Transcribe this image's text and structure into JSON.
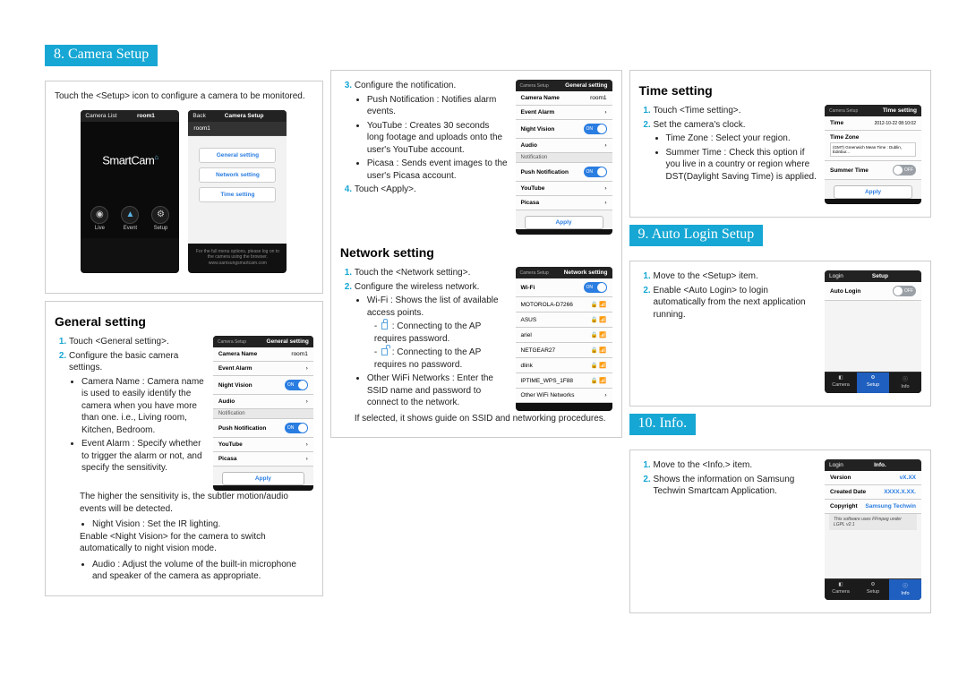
{
  "sections": {
    "camera_setup": {
      "title": "8. Camera Setup",
      "intro": "Touch the <Setup> icon to configure a camera to be monitored.",
      "general": {
        "heading": "General setting",
        "step1": "Touch <General setting>.",
        "step2": "Configure the basic camera settings.",
        "b1": "Camera Name : Camera name is used to easily identify the camera when you have more than one. i.e., Living room, Kitchen, Bedroom.",
        "b2": "Event Alarm : Specify whether to trigger the alarm or not, and specify the sensitivity.",
        "b2_note": "The higher the sensitivity is, the subtler motion/audio events will be detected.",
        "b3": "Night Vision : Set the IR lighting.",
        "b3_note": "Enable <Night Vision> for the camera to switch automatically to night vision mode.",
        "b4": "Audio : Adjust the volume of the built-in microphone and speaker of the camera as appropriate."
      },
      "network": {
        "heading": "Network setting",
        "n3": "Configure the notification.",
        "n3_b1": "Push Notification : Notifies alarm events.",
        "n3_b2": "YouTube : Creates 30 seconds long footage and uploads onto the user's YouTube account.",
        "n3_b3": "Picasa : Sends event images to the user's Picasa account.",
        "n4": "Touch <Apply>.",
        "step1": "Touch the <Network setting>.",
        "step2": "Configure the wireless network.",
        "s2_b1": "Wi-Fi : Shows the list of available access points.",
        "s2_b1a": ": Connecting to the AP requires password.",
        "s2_b1b": ": Connecting to the AP requires no password.",
        "s2_b2": "Other WiFi Networks : Enter the SSID name and password to connect to the network.",
        "note": "If selected, it shows guide on SSID and networking procedures."
      }
    },
    "time": {
      "heading": "Time setting",
      "t1": "Touch <Time setting>.",
      "t2": "Set the camera's clock.",
      "t2_b1": "Time Zone : Select your region.",
      "t2_b2": "Summer Time : Check this option if you live in a country or region where DST(Daylight Saving Time) is applied."
    },
    "auto_login": {
      "title": "9. Auto Login Setup",
      "a1": "Move to the <Setup> item.",
      "a2": "Enable <Auto Login> to login automatically from the next application running."
    },
    "info": {
      "title": "10. Info.",
      "i1": "Move to the <Info.> item.",
      "i2": "Shows the information on Samsung Techwin Smartcam Application."
    }
  },
  "shots": {
    "home": {
      "topbar_left": "Camera List",
      "topbar_title": "room1",
      "brand": "SmartCam",
      "live": "Live",
      "event": "Event",
      "setup": "Setup"
    },
    "setup_menu": {
      "back": "Back",
      "title": "Camera Setup",
      "room": "room1",
      "m1": "General setting",
      "m2": "Network setting",
      "m3": "Time setting",
      "foot": "For the full menu options, please log on to the camera using the browser.",
      "url": "www.samsungsmartcam.com"
    },
    "general": {
      "crumb": "Camera Setup",
      "title": "General setting",
      "r1": "Camera Name",
      "r1v": "room1",
      "r2": "Event Alarm",
      "r3": "Night Vision",
      "r4": "Audio",
      "grp": "Notification",
      "r5": "Push Notification",
      "r6": "YouTube",
      "r7": "Picasa",
      "apply": "Apply",
      "on": "ON"
    },
    "network": {
      "crumb": "Camera Setup",
      "title": "Network setting",
      "wifi": "Wi-Fi",
      "ap1": "MOTOROLA-D7266",
      "ap2": "ASUS",
      "ap3": "ariel",
      "ap4": "NETGEAR27",
      "ap5": "dlink",
      "ap6": "IPTIME_WPS_1F88",
      "other": "Other WiFi Networks",
      "on": "ON"
    },
    "time": {
      "crumb": "Camera Setup",
      "title": "Time setting",
      "r1": "Time",
      "r1v": "2012-10-22  08:10:02",
      "r2": "Time Zone",
      "r2v": "(GMT) Greenwich Mean Time : Dublin, Edinbur...",
      "r3": "Summer Time",
      "off": "OFF",
      "apply": "Apply"
    },
    "autologin": {
      "back": "Login",
      "title": "Setup",
      "row": "Auto Login",
      "off": "OFF",
      "tab1": "Camera",
      "tab2": "Setup",
      "tab3": "Info"
    },
    "info_shot": {
      "back": "Login",
      "title": "Info.",
      "r1": "Version",
      "r1v": "vX.XX",
      "r2": "Created Date",
      "r2v": "XXXX.X.XX.",
      "r3": "Copyright",
      "r3v": "Samsung Techwin",
      "note": "This software uses FFmpeg under LGPL v2.1",
      "tab1": "Camera",
      "tab2": "Setup",
      "tab3": "Info"
    }
  }
}
